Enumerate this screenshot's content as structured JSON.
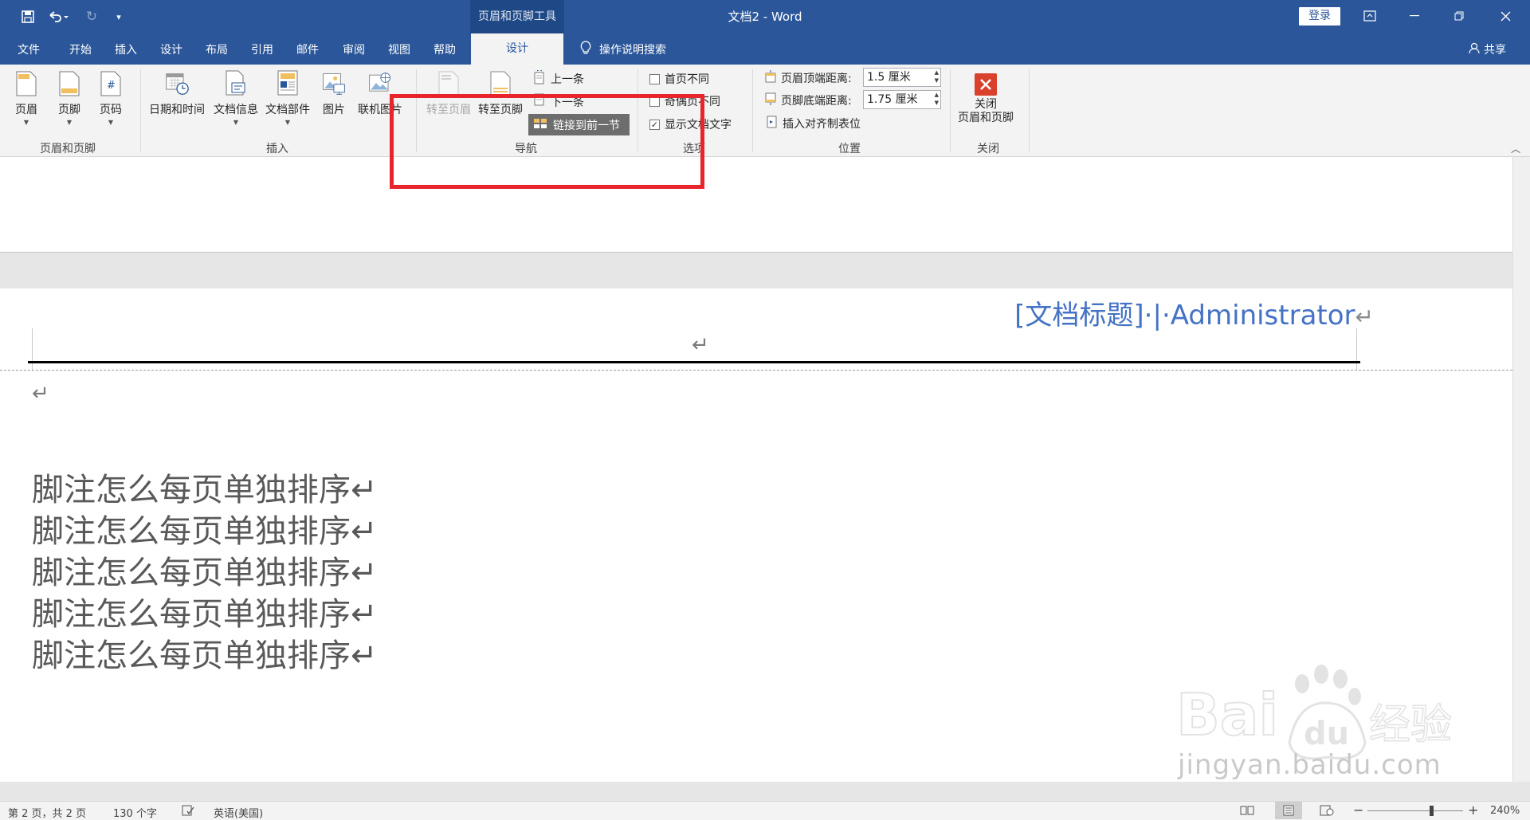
{
  "app": {
    "doc_title": "文档2  -  Word",
    "context_tab_group": "页眉和页脚工具",
    "login": "登录"
  },
  "quick_access": {
    "save_icon": "save-icon",
    "undo_icon": "undo-icon",
    "redo_icon": "redo-icon",
    "customize_icon": "customize-icon"
  },
  "tabs": [
    "文件",
    "开始",
    "插入",
    "设计",
    "布局",
    "引用",
    "邮件",
    "审阅",
    "视图",
    "帮助"
  ],
  "active_tab": "设计",
  "tell_me": "操作说明搜索",
  "share": "共享",
  "ribbon": {
    "group_header_footer": {
      "label": "页眉和页脚",
      "buttons": [
        "页眉",
        "页脚",
        "页码"
      ]
    },
    "group_insert": {
      "label": "插入",
      "buttons": [
        "日期和时间",
        "文档信息",
        "文档部件",
        "图片",
        "联机图片"
      ]
    },
    "group_nav": {
      "label": "导航",
      "goto_header": "转至页眉",
      "goto_footer": "转至页脚",
      "prev": "上一条",
      "next": "下一条",
      "link_prev": "链接到前一节"
    },
    "group_options": {
      "label": "选项",
      "diff_first": "首页不同",
      "diff_odd_even": "奇偶页不同",
      "show_doc_text": "显示文档文字"
    },
    "group_position": {
      "label": "位置",
      "header_top_label": "页眉顶端距离:",
      "header_top_value": "1.5 厘米",
      "footer_bottom_label": "页脚底端距离:",
      "footer_bottom_value": "1.75 厘米",
      "insert_align_tab": "插入对齐制表位"
    },
    "group_close": {
      "label": "关闭",
      "button_line1": "关闭",
      "button_line2": "页眉和页脚"
    }
  },
  "document": {
    "header_text": "[文档标题]·|·Administrator",
    "return_mark": "↵",
    "body_lines": [
      "脚注怎么每页单独排序↵",
      "脚注怎么每页单独排序↵",
      "脚注怎么每页单独排序↵",
      "脚注怎么每页单独排序↵",
      "脚注怎么每页单独排序↵"
    ]
  },
  "status_bar": {
    "page": "第 2 页，共 2 页",
    "words": "130 个字",
    "language": "英语(美国)",
    "zoom": "240%"
  },
  "watermark": {
    "brand": "Bai",
    "brand2": "du",
    "cn": "经验",
    "url": "jingyan.baidu.com"
  },
  "colors": {
    "titlebar": "#2b579a",
    "accent_header": "#4472c4",
    "highlight": "#e8252d",
    "close_red": "#d9412c"
  }
}
